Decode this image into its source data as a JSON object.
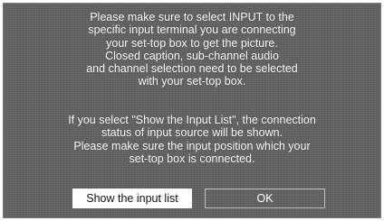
{
  "dialog": {
    "message_1": [
      "Please make sure to select INPUT to the",
      "specific input terminal you are connecting",
      "your set-top box to get the picture.",
      "Closed caption, sub-channel audio",
      "and channel selection need to be selected",
      "with your set-top box."
    ],
    "message_2": [
      "If you select \"Show the Input List\", the connection",
      "status of input source will be shown.",
      "Please make sure the input position which your",
      "set-top box is connected."
    ],
    "buttons": {
      "show_input_list": "Show the input list",
      "ok": "OK"
    }
  }
}
